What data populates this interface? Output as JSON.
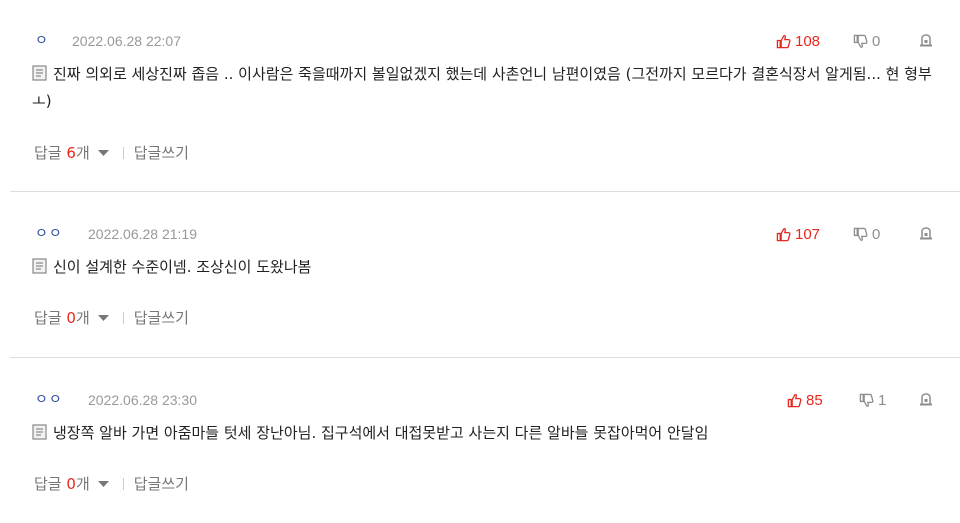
{
  "comments": [
    {
      "nickname": "ㅇ",
      "date": "2022.06.28 22:07",
      "upvotes": "108",
      "downvotes": "0",
      "text": "진짜 의외로 세상진짜 좁음 .. 이사람은 죽을때까지 볼일없겠지 했는데 사촌언니 남편이였음 (그전까지 모르다가 결혼식장서 알게됨... 현 형부 ㅗ)",
      "reply_label": "답글",
      "reply_count": "6",
      "reply_unit": "개",
      "write_reply_label": "답글쓰기"
    },
    {
      "nickname": "ㅇㅇ",
      "date": "2022.06.28 21:19",
      "upvotes": "107",
      "downvotes": "0",
      "text": "신이 설계한 수준이넴. 조상신이 도왔나봄",
      "reply_label": "답글",
      "reply_count": "0",
      "reply_unit": "개",
      "write_reply_label": "답글쓰기"
    },
    {
      "nickname": "ㅇㅇ",
      "date": "2022.06.28 23:30",
      "upvotes": "85",
      "downvotes": "1",
      "text": "냉장쪽 알바 가면 아줌마들 텃세 장난아님. 집구석에서 대접못받고 사는지 다른 알바들 못잡아먹어 안달임",
      "reply_label": "답글",
      "reply_count": "0",
      "reply_unit": "개",
      "write_reply_label": "답글쓰기"
    }
  ],
  "icons": {
    "upvote": "thumbs-up-icon",
    "downvote": "thumbs-down-icon",
    "report": "report-icon",
    "document": "document-icon",
    "expand": "chevron-down-icon"
  },
  "colors": {
    "accent_red": "#e8281e",
    "muted_gray": "#999999",
    "nick_blue": "#2c4a9a",
    "divider": "#dddddd"
  }
}
